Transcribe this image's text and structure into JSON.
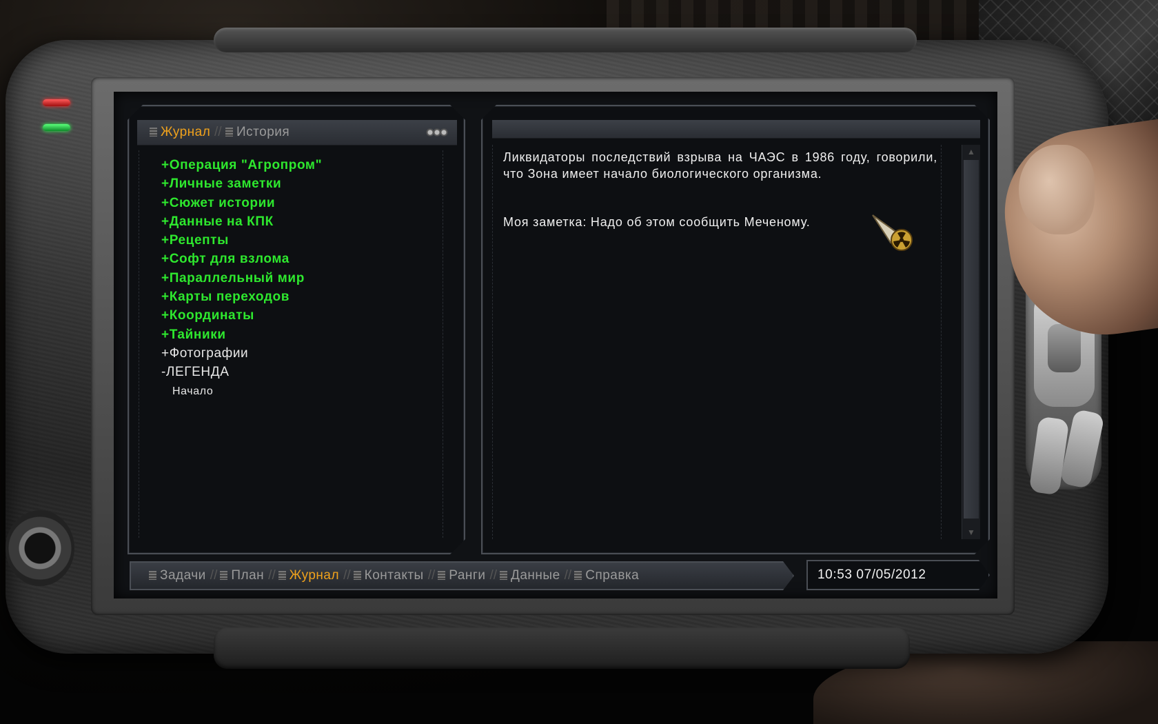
{
  "pda": {
    "top_tabs": [
      {
        "label": "Журнал",
        "active": true
      },
      {
        "label": "История",
        "active": false
      }
    ],
    "separator": "//",
    "journal_items": [
      {
        "label": "+Операция \"Агропром\"",
        "style": "green"
      },
      {
        "label": "+Личные заметки",
        "style": "green"
      },
      {
        "label": "+Сюжет истории",
        "style": "green"
      },
      {
        "label": "+Данные на КПК",
        "style": "green"
      },
      {
        "label": "+Рецепты",
        "style": "green"
      },
      {
        "label": "+Софт для взлома",
        "style": "green"
      },
      {
        "label": "+Параллельный мир",
        "style": "green"
      },
      {
        "label": "+Карты переходов",
        "style": "green"
      },
      {
        "label": "+Координаты",
        "style": "green"
      },
      {
        "label": "+Тайники",
        "style": "green"
      },
      {
        "label": "+Фотографии",
        "style": "white"
      },
      {
        "label": "-ЛЕГЕНДА",
        "style": "white"
      },
      {
        "label": "Начало",
        "style": "sub"
      }
    ],
    "content": {
      "paragraph1": "Ликвидаторы последствий взрыва на ЧАЭС в 1986 году, говорили, что Зона имеет начало биологического организма.",
      "paragraph2": "Моя заметка: Надо об этом сообщить Меченому."
    },
    "bottom_tabs": [
      {
        "label": "Задачи",
        "active": false
      },
      {
        "label": "План",
        "active": false
      },
      {
        "label": "Журнал",
        "active": true
      },
      {
        "label": "Контакты",
        "active": false
      },
      {
        "label": "Ранги",
        "active": false
      },
      {
        "label": "Данные",
        "active": false
      },
      {
        "label": "Справка",
        "active": false
      }
    ],
    "clock": "10:53  07/05/2012"
  },
  "colors": {
    "active_tab": "#f0a21c",
    "inactive_tab": "#9a9a9a",
    "journal_green": "#2ee82e",
    "text_white": "#f0f0f0",
    "screen_bg": "#101215"
  },
  "icons": {
    "tab_icon": "document-icon",
    "settings": "gear-icon",
    "marker": "radiation-marker-icon"
  }
}
